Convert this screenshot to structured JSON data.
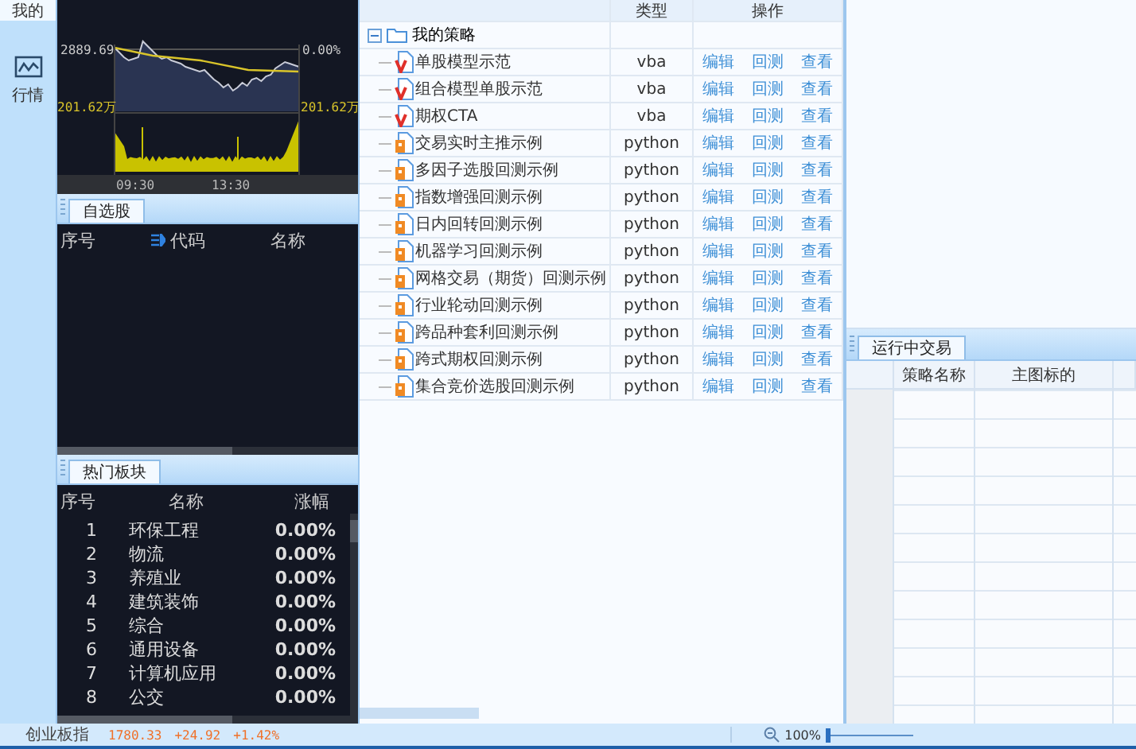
{
  "nav": [
    {
      "label": "我的",
      "selected": true,
      "kind": "plain"
    },
    {
      "label": "行情",
      "selected": false,
      "kind": "chart"
    }
  ],
  "minute_chart": {
    "price": "2889.69",
    "change": "0.00%",
    "volume_left": "201.62万",
    "volume_right": "201.62万",
    "times": [
      "09:30",
      "13:30"
    ]
  },
  "watchlist": {
    "tab": "自选股",
    "columns": [
      "序号",
      "代码",
      "名称"
    ]
  },
  "hot_sectors": {
    "tab": "热门板块",
    "columns": [
      "序号",
      "名称",
      "涨幅"
    ],
    "rows": [
      {
        "no": "1",
        "name": "环保工程",
        "change": "0.00%"
      },
      {
        "no": "2",
        "name": "物流",
        "change": "0.00%"
      },
      {
        "no": "3",
        "name": "养殖业",
        "change": "0.00%"
      },
      {
        "no": "4",
        "name": "建筑装饰",
        "change": "0.00%"
      },
      {
        "no": "5",
        "name": "综合",
        "change": "0.00%"
      },
      {
        "no": "6",
        "name": "通用设备",
        "change": "0.00%"
      },
      {
        "no": "7",
        "name": "计算机应用",
        "change": "0.00%"
      },
      {
        "no": "8",
        "name": "公交",
        "change": "0.00%"
      }
    ]
  },
  "strategies": {
    "columns": [
      "类型",
      "操作"
    ],
    "root": {
      "label": "我的策略",
      "expanded": true,
      "children": [
        {
          "name": "单股模型示范",
          "kind": "vba",
          "type": "vba",
          "actions": [
            "编辑",
            "回测",
            "查看"
          ]
        },
        {
          "name": "组合模型单股示范",
          "kind": "vba",
          "type": "vba",
          "actions": [
            "编辑",
            "回测",
            "查看"
          ]
        },
        {
          "name": "期权CTA",
          "kind": "vba",
          "type": "vba",
          "actions": [
            "编辑",
            "回测",
            "查看"
          ]
        },
        {
          "name": "交易实时主推示例",
          "kind": "python",
          "type": "python",
          "actions": [
            "编辑",
            "回测",
            "查看"
          ]
        },
        {
          "name": "多因子选股回测示例",
          "kind": "python",
          "type": "python",
          "actions": [
            "编辑",
            "回测",
            "查看"
          ]
        },
        {
          "name": "指数增强回测示例",
          "kind": "python",
          "type": "python",
          "actions": [
            "编辑",
            "回测",
            "查看"
          ]
        },
        {
          "name": "日内回转回测示例",
          "kind": "python",
          "type": "python",
          "actions": [
            "编辑",
            "回测",
            "查看"
          ]
        },
        {
          "name": "机器学习回测示例",
          "kind": "python",
          "type": "python",
          "actions": [
            "编辑",
            "回测",
            "查看"
          ]
        },
        {
          "name": "网格交易（期货）回测示例",
          "kind": "python",
          "type": "python",
          "actions": [
            "编辑",
            "回测",
            "查看"
          ]
        },
        {
          "name": "行业轮动回测示例",
          "kind": "python",
          "type": "python",
          "actions": [
            "编辑",
            "回测",
            "查看"
          ]
        },
        {
          "name": "跨品种套利回测示例",
          "kind": "python",
          "type": "python",
          "actions": [
            "编辑",
            "回测",
            "查看"
          ]
        },
        {
          "name": "跨式期权回测示例",
          "kind": "python",
          "type": "python",
          "actions": [
            "编辑",
            "回测",
            "查看"
          ]
        },
        {
          "name": "集合竞价选股回测示例",
          "kind": "python",
          "type": "python",
          "actions": [
            "编辑",
            "回测",
            "查看"
          ]
        }
      ]
    }
  },
  "running_trades": {
    "tab": "运行中交易",
    "columns": [
      "策略名称",
      "主图标的"
    ]
  },
  "status_bar": {
    "index_name": "创业板指",
    "index_value": "1780.33",
    "index_change": "+24.92",
    "index_percent": "+1.42%",
    "zoom": {
      "label": "100%",
      "level": 0
    }
  }
}
